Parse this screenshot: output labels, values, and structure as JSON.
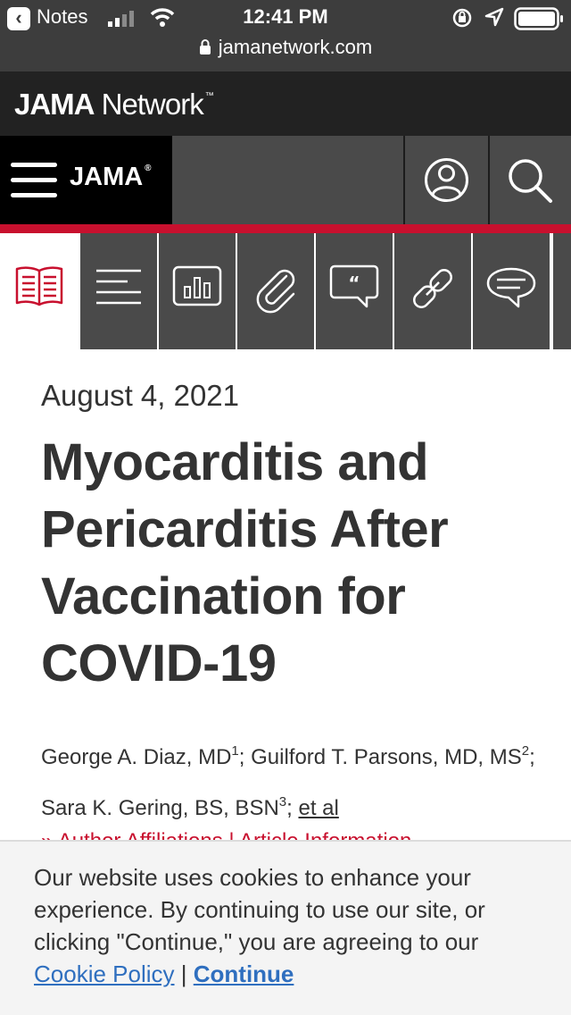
{
  "status_bar": {
    "back_app": "Notes",
    "time": "12:41 PM",
    "url": "jamanetwork.com"
  },
  "network_bar": {
    "brand_bold": "JAMA",
    "brand_rest": " Network",
    "brand_mark": "™"
  },
  "journal_bar": {
    "title": "JAMA",
    "title_mark": "®"
  },
  "tabs": [
    {
      "icon": "book-icon",
      "active": true
    },
    {
      "icon": "list-icon",
      "active": false
    },
    {
      "icon": "chart-icon",
      "active": false
    },
    {
      "icon": "paperclip-icon",
      "active": false
    },
    {
      "icon": "quote-icon",
      "active": false
    },
    {
      "icon": "link-icon",
      "active": false
    },
    {
      "icon": "comment-icon",
      "active": false
    }
  ],
  "article": {
    "date": "August 4, 2021",
    "title": "Myocarditis and Pericarditis After Vaccination for COVID-19",
    "authors": [
      {
        "name": "George A. Diaz, MD",
        "ref": "1"
      },
      {
        "name": "Guilford T. Parsons, MD, MS",
        "ref": "2"
      },
      {
        "name": "Sara K. Gering, BS, BSN",
        "ref": "3"
      }
    ],
    "et_al": "et al",
    "affiliations_link": "» Author Affiliations | Article Information"
  },
  "cookie_banner": {
    "message": "Our website uses cookies to enhance your experience. By continuing to use our site, or clicking \"Continue,\" you are agreeing to our",
    "policy_link": "Cookie Policy",
    "separator": "|",
    "continue_link": "Continue"
  },
  "colors": {
    "accent_red": "#c8102e",
    "dark_bar": "#222222",
    "tab_gray": "#4a4a4a",
    "link_blue": "#2f6fbf"
  }
}
